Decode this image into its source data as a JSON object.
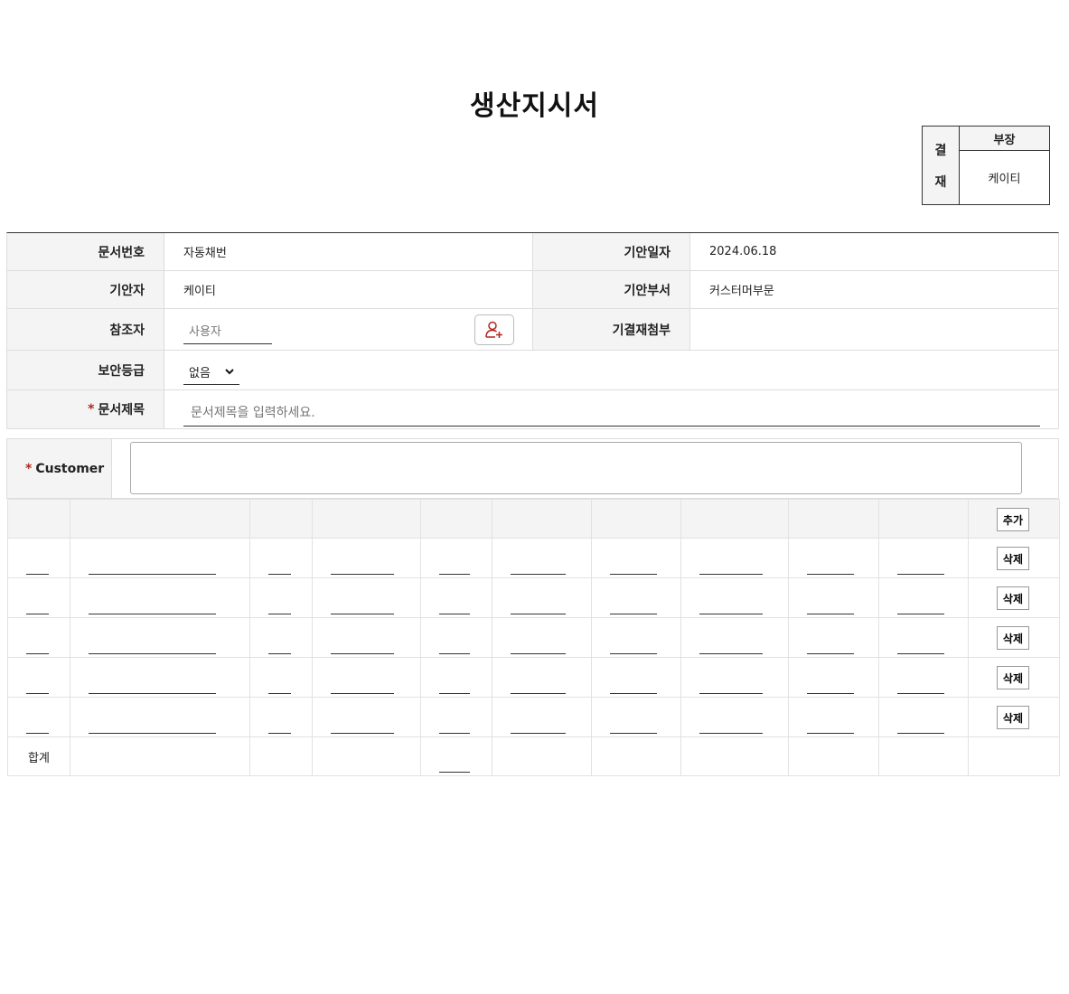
{
  "doc_title": "생산지시서",
  "approval": {
    "side_chars": [
      "결",
      "재"
    ],
    "role": "부장",
    "approver": "케이티"
  },
  "info": {
    "doc_no_label": "문서번호",
    "doc_no_value": "자동채번",
    "draft_date_label": "기안일자",
    "draft_date_value": "2024.06.18",
    "drafter_label": "기안자",
    "drafter_value": "케이티",
    "dept_label": "기안부서",
    "dept_value": "커스터머부문",
    "ref_label": "참조자",
    "ref_placeholder": "사용자",
    "attach_label": "기결재첨부",
    "security_label": "보안등급",
    "security_value": "없음",
    "title_label": "문서제목",
    "title_required_mark": "*",
    "title_placeholder": "문서제목을 입력하세요."
  },
  "customer": {
    "required_mark": "*",
    "label": "Customer",
    "value": ""
  },
  "grid": {
    "add_label": "추가",
    "delete_label": "삭제",
    "row_count": 5,
    "sum_label": "합계"
  }
}
